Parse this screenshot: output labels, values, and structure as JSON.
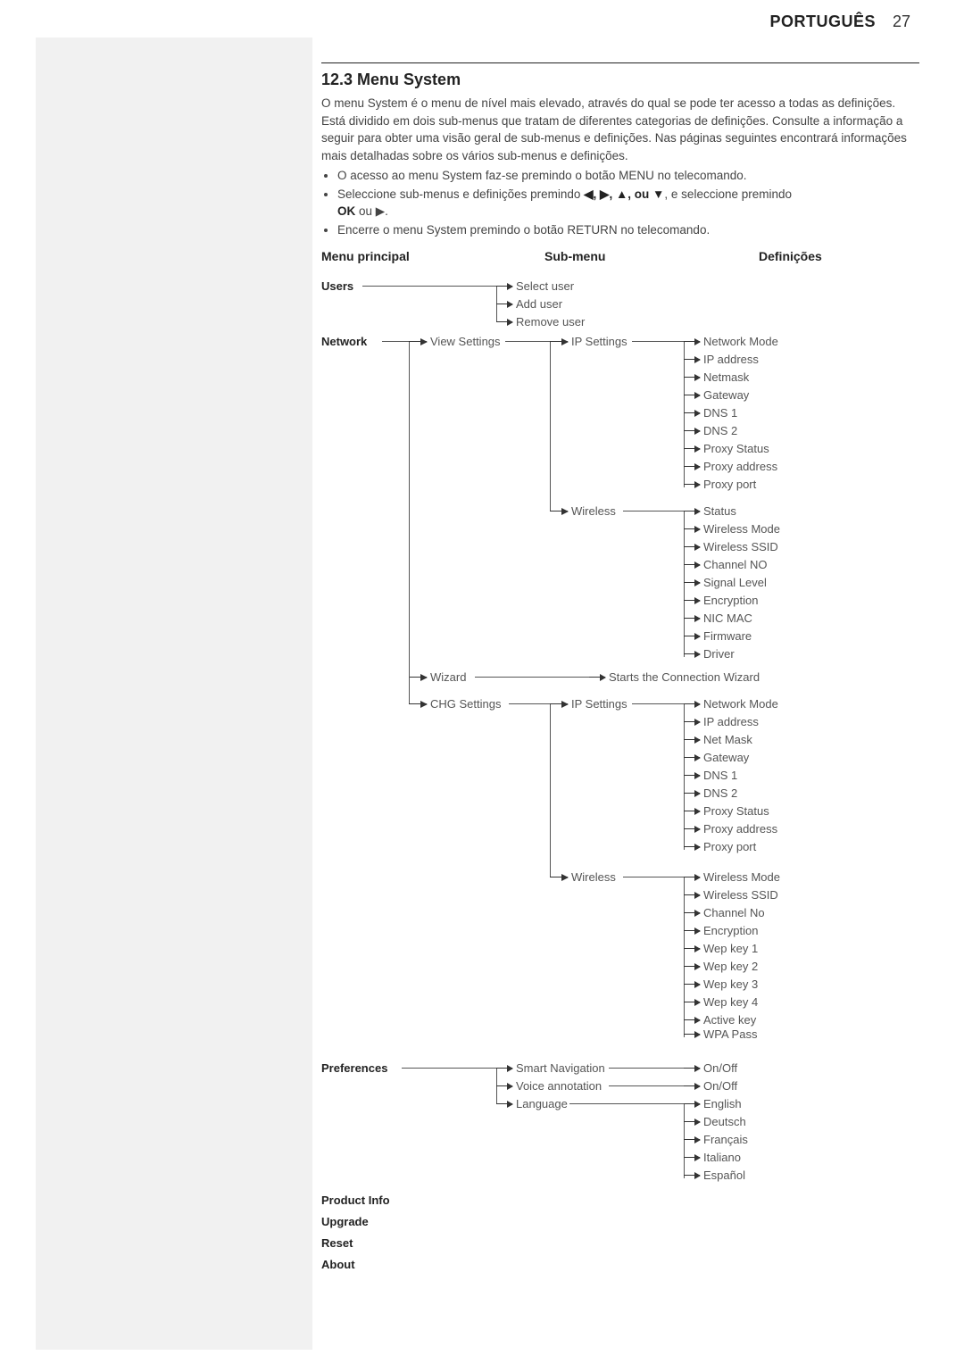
{
  "header": {
    "lang": "PORTUGUÊS",
    "page_no": "27"
  },
  "section_title": "12.3 Menu System",
  "paragraph": "O menu System é o menu de nível mais elevado, através do qual se pode ter acesso a todas as definições. Está dividido em dois sub-menus que tratam de diferentes categorias de definições. Consulte a informação a seguir para obter uma visão geral de sub-menus e definições. Nas páginas seguintes encontrará informações mais detalhadas sobre os vários sub-menus e definições.",
  "bullets": {
    "b0": "O acesso ao menu System faz-se premindo o botão MENU no telecomando.",
    "b1_prefix": "Seleccione sub-menus e definições premindo ",
    "b1_arrows": "◀, ▶, ▲, ou ▼",
    "b1_mid": ", e seleccione premindo ",
    "b1_ok": "OK",
    "b1_suffix": " ou ▶.",
    "b2": "Encerre o menu System premindo o botão RETURN no telecomando."
  },
  "columns": {
    "main": "Menu principal",
    "sub": "Sub-menu",
    "def": "Definições"
  },
  "main": {
    "users": "Users",
    "network": "Network",
    "preferences": "Preferences",
    "product_info": "Product Info",
    "upgrade": "Upgrade",
    "reset": "Reset",
    "about": "About"
  },
  "users_sub": {
    "select": "Select user",
    "add": "Add user",
    "remove": "Remove user"
  },
  "network_sub": {
    "view": "View Settings",
    "wizard": "Wizard",
    "chg": "CHG Settings"
  },
  "network_view_sub": {
    "ip": "IP Settings",
    "wireless": "Wireless"
  },
  "ip_view_defs": {
    "d0": "Network Mode",
    "d1": "IP address",
    "d2": "Netmask",
    "d3": "Gateway",
    "d4": "DNS 1",
    "d5": "DNS 2",
    "d6": "Proxy Status",
    "d7": "Proxy address",
    "d8": "Proxy port"
  },
  "wireless_view_defs": {
    "d0": "Status",
    "d1": "Wireless Mode",
    "d2": "Wireless SSID",
    "d3": "Channel NO",
    "d4": "Signal Level",
    "d5": "Encryption",
    "d6": "NIC MAC",
    "d7": "Firmware",
    "d8": "Driver"
  },
  "wizard_def": "Starts the Connection Wizard",
  "chg_sub": {
    "ip": "IP Settings",
    "wireless": "Wireless"
  },
  "ip_chg_defs": {
    "d0": "Network Mode",
    "d1": "IP address",
    "d2": "Net Mask",
    "d3": "Gateway",
    "d4": "DNS 1",
    "d5": "DNS 2",
    "d6": "Proxy Status",
    "d7": "Proxy address",
    "d8": "Proxy port"
  },
  "wireless_chg_defs": {
    "d0": "Wireless Mode",
    "d1": "Wireless SSID",
    "d2": "Channel No",
    "d3": "Encryption",
    "d4": "Wep key 1",
    "d5": "Wep key 2",
    "d6": "Wep key 3",
    "d7": "Wep key 4",
    "d8": "Active key",
    "d9": "WPA Pass"
  },
  "pref_sub": {
    "smart": "Smart Navigation",
    "voice": "Voice annotation",
    "lang": "Language"
  },
  "pref_onoff": "On/Off",
  "pref_langs": {
    "l0": "English",
    "l1": "Deutsch",
    "l2": "Français",
    "l3": "Italiano",
    "l4": "Español"
  }
}
